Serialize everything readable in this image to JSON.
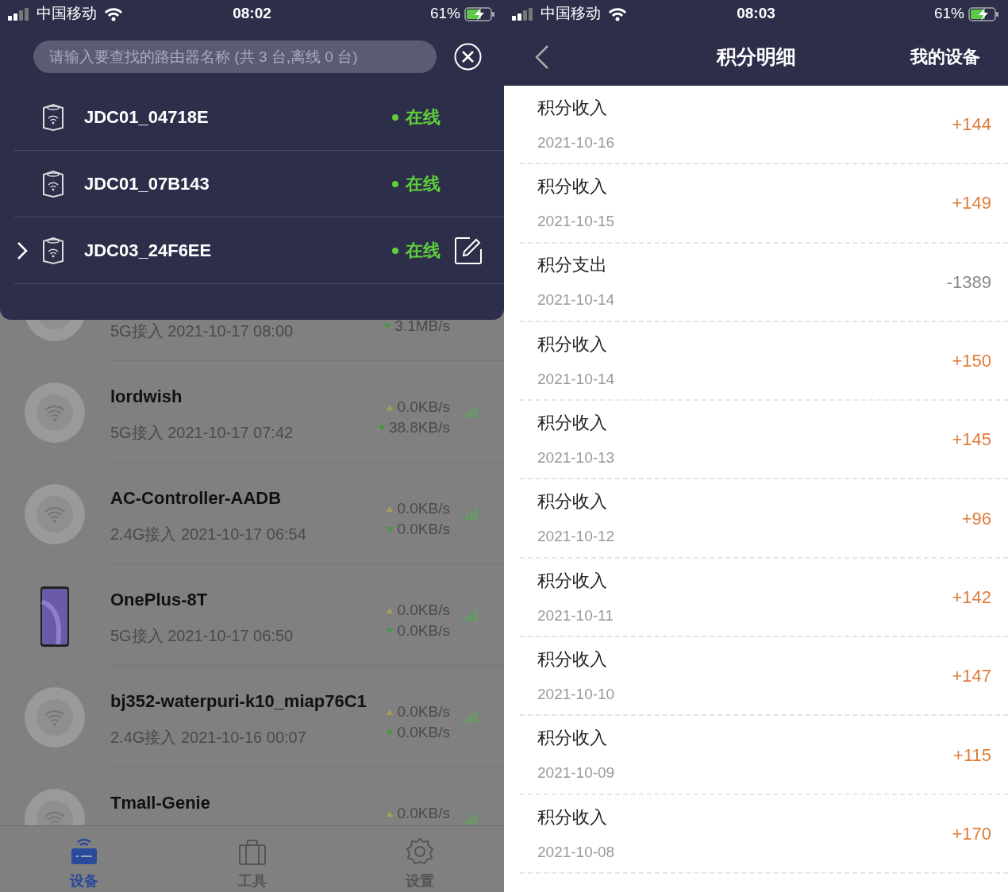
{
  "left_screen": {
    "status_bar": {
      "carrier": "中国移动",
      "time": "08:02",
      "battery": "61%"
    },
    "router_picker": {
      "search": {
        "placeholder": "请输入要查找的路由器名称 (共 3 台,离线 0 台)"
      },
      "routers": [
        {
          "name": "JDC01_04718E",
          "status": "在线",
          "selected": false
        },
        {
          "name": "JDC01_07B143",
          "status": "在线",
          "selected": false
        },
        {
          "name": "JDC03_24F6EE",
          "status": "在线",
          "selected": true
        }
      ]
    },
    "devices": [
      {
        "kind": "wifi",
        "subtitle": "5G接入 2021-10-17 08:00",
        "down": "3.1MB/s"
      },
      {
        "kind": "wifi",
        "name": "lordwish",
        "subtitle": "5G接入 2021-10-17 07:42",
        "up": "0.0KB/s",
        "down": "38.8KB/s"
      },
      {
        "kind": "wifi",
        "name": "AC-Controller-AADB",
        "subtitle": "2.4G接入 2021-10-17 06:54",
        "up": "0.0KB/s",
        "down": "0.0KB/s"
      },
      {
        "kind": "phone",
        "name": "OnePlus-8T",
        "subtitle": "5G接入 2021-10-17 06:50",
        "up": "0.0KB/s",
        "down": "0.0KB/s"
      },
      {
        "kind": "wifi",
        "name": "bj352-waterpuri-k10_miap76C1",
        "subtitle": "2.4G接入 2021-10-16 00:07",
        "up": "0.0KB/s",
        "down": "0.0KB/s"
      },
      {
        "kind": "wifi",
        "name": "Tmall-Genie",
        "up": "0.0KB/s"
      }
    ],
    "tab_bar": [
      {
        "label": "设备",
        "selected": true
      },
      {
        "label": "工具",
        "selected": false
      },
      {
        "label": "设置",
        "selected": false
      }
    ]
  },
  "right_screen": {
    "status_bar": {
      "carrier": "中国移动",
      "time": "08:03",
      "battery": "61%"
    },
    "header": {
      "title": "积分明细",
      "action": "我的设备"
    },
    "records": [
      {
        "kind": "income",
        "title": "积分收入",
        "date": "2021-10-16",
        "amount": "+144"
      },
      {
        "kind": "income",
        "title": "积分收入",
        "date": "2021-10-15",
        "amount": "+149"
      },
      {
        "kind": "expense",
        "title": "积分支出",
        "date": "2021-10-14",
        "amount": "-1389"
      },
      {
        "kind": "income",
        "title": "积分收入",
        "date": "2021-10-14",
        "amount": "+150"
      },
      {
        "kind": "income",
        "title": "积分收入",
        "date": "2021-10-13",
        "amount": "+145"
      },
      {
        "kind": "income",
        "title": "积分收入",
        "date": "2021-10-12",
        "amount": "+96"
      },
      {
        "kind": "income",
        "title": "积分收入",
        "date": "2021-10-11",
        "amount": "+142"
      },
      {
        "kind": "income",
        "title": "积分收入",
        "date": "2021-10-10",
        "amount": "+147"
      },
      {
        "kind": "income",
        "title": "积分收入",
        "date": "2021-10-09",
        "amount": "+115"
      },
      {
        "kind": "income",
        "title": "积分收入",
        "date": "2021-10-08",
        "amount": "+170"
      }
    ]
  }
}
